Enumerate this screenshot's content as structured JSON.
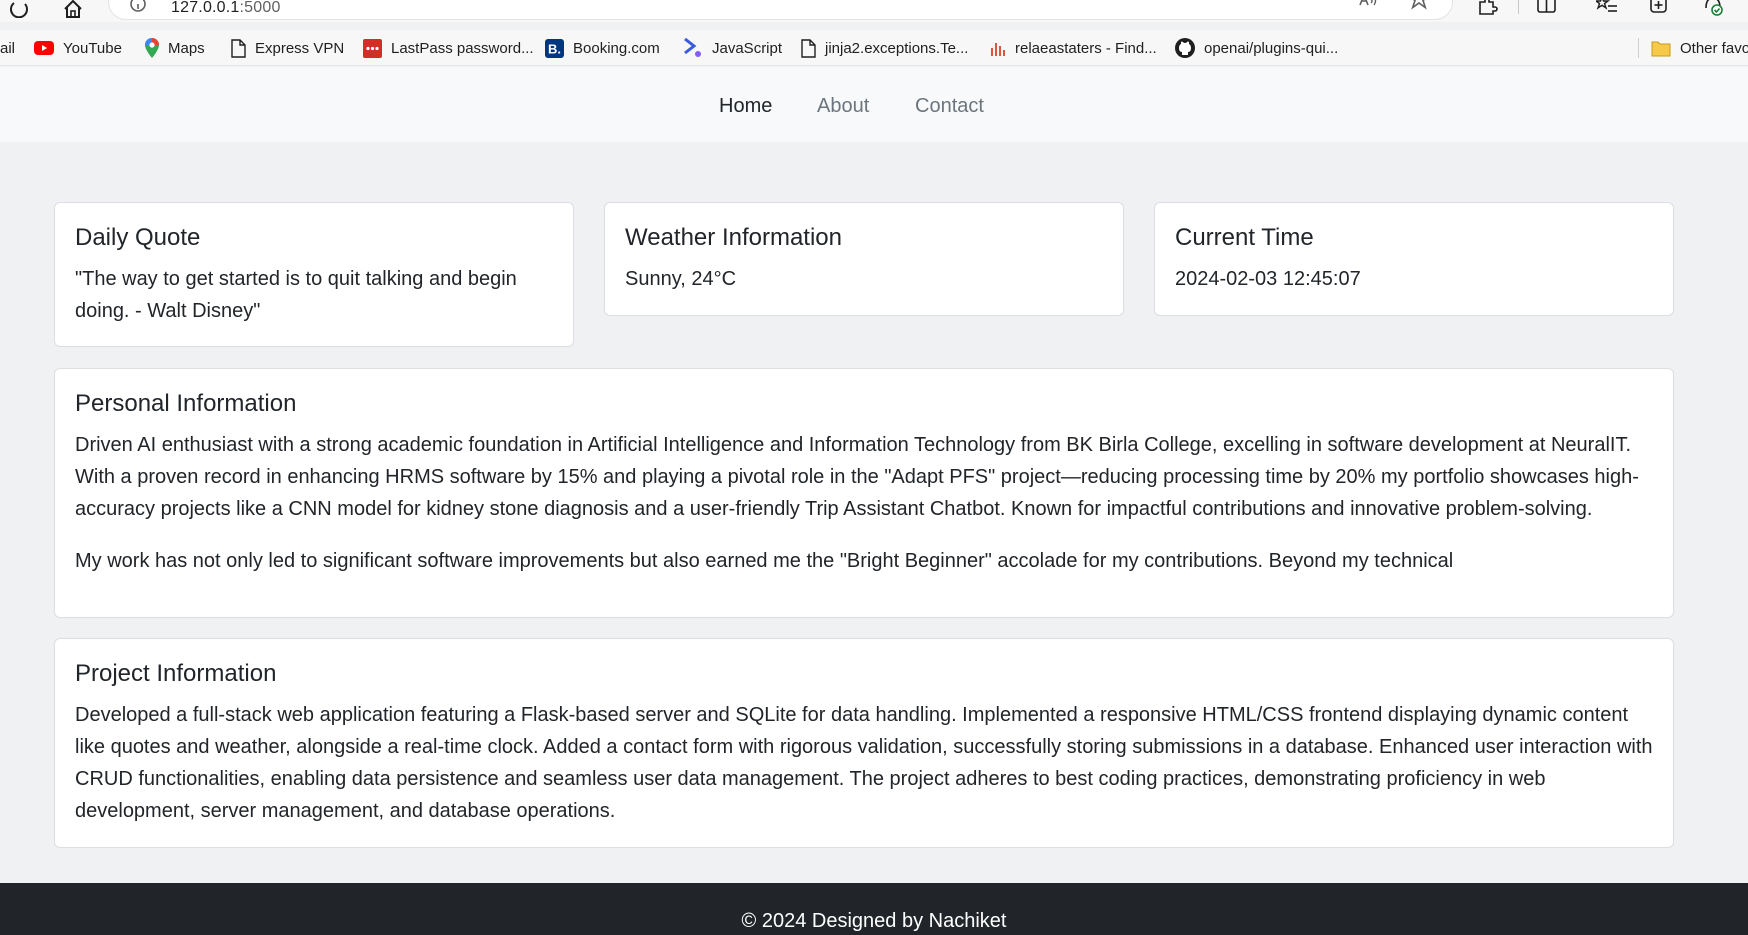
{
  "browser": {
    "url_host": "127.0.0.1",
    "url_port": ":5000",
    "bookmarks": [
      {
        "label": "ail",
        "icon": "mail-icon"
      },
      {
        "label": "YouTube",
        "icon": "youtube-icon"
      },
      {
        "label": "Maps",
        "icon": "maps-icon"
      },
      {
        "label": "Express VPN",
        "icon": "page-icon"
      },
      {
        "label": "LastPass password...",
        "icon": "lastpass-icon"
      },
      {
        "label": "Booking.com",
        "icon": "booking-icon"
      },
      {
        "label": "JavaScript",
        "icon": "javascript-icon"
      },
      {
        "label": "jinja2.exceptions.Te...",
        "icon": "page-icon"
      },
      {
        "label": "relaeastaters - Find...",
        "icon": "chart-icon"
      },
      {
        "label": "openai/plugins-qui...",
        "icon": "github-icon"
      },
      {
        "label": "Other favo",
        "icon": "folder-icon"
      }
    ]
  },
  "nav": {
    "home": "Home",
    "about": "About",
    "contact": "Contact"
  },
  "quote": {
    "title": "Daily Quote",
    "text": "\"The way to get started is to quit talking and begin doing. - Walt Disney\""
  },
  "weather": {
    "title": "Weather Information",
    "text": "Sunny, 24°C"
  },
  "time": {
    "title": "Current Time",
    "text": "2024-02-03 12:45:07"
  },
  "personal": {
    "title": "Personal Information",
    "paragraph1": "Driven AI enthusiast with a strong academic foundation in Artificial Intelligence and Information Technology from BK Birla College, excelling in software development at NeuralIT. With a proven record in enhancing HRMS software by 15% and playing a pivotal role in the \"Adapt PFS\" project—reducing processing time by 20% my portfolio showcases high-accuracy projects like a CNN model for kidney stone diagnosis and a user-friendly Trip Assistant Chatbot. Known for impactful contributions and innovative problem-solving.",
    "paragraph2": "My work has not only led to significant software improvements but also earned me the \"Bright Beginner\" accolade for my contributions. Beyond my technical"
  },
  "project": {
    "title": "Project Information",
    "text": "Developed a full-stack web application featuring a Flask-based server and SQLite for data handling. Implemented a responsive HTML/CSS frontend displaying dynamic content like quotes and weather, alongside a real-time clock. Added a contact form with rigorous validation, successfully storing submissions in a database. Enhanced user interaction with CRUD functionalities, enabling data persistence and seamless user data management. The project adheres to best coding practices, demonstrating proficiency in web development, server management, and database operations."
  },
  "footer": {
    "text": "© 2024 Designed by Nachiket"
  },
  "colors": {
    "page_bg": "#f0f1f3",
    "nav_bg": "#f8f9fa",
    "footer_bg": "#212529",
    "text": "#212529",
    "muted_link": "#6c757d"
  }
}
